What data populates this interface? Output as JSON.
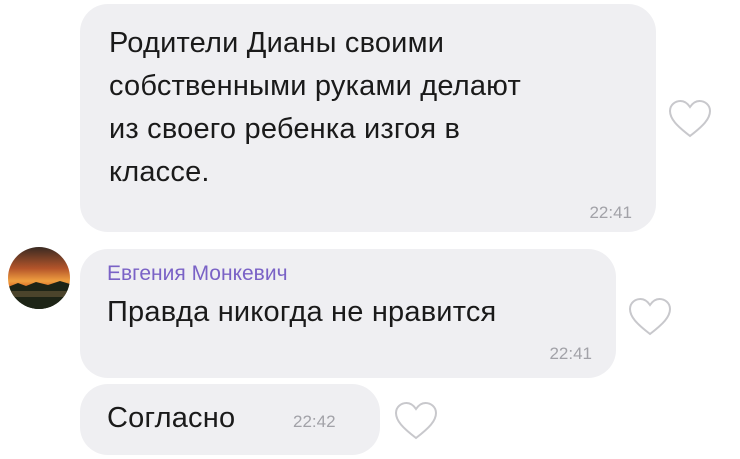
{
  "messages": [
    {
      "text": "Родители Дианы своими\nсобственными руками делают\nиз своего ребенка изгоя в\nклассе.",
      "time": "22:41",
      "like_icon": "heart-outline-icon"
    },
    {
      "sender": "Евгения Монкевич",
      "text": "Правда никогда не нравится",
      "time": "22:41",
      "avatar_icon": "sunset-landscape-avatar",
      "like_icon": "heart-outline-icon"
    },
    {
      "text": "Согласно",
      "time": "22:42",
      "like_icon": "heart-outline-icon"
    }
  ],
  "colors": {
    "bubble_bg": "#efeff2",
    "text": "#1a1a1a",
    "time": "#a2a2a8",
    "sender": "#7a62c6",
    "heart": "#c8c8cc"
  }
}
